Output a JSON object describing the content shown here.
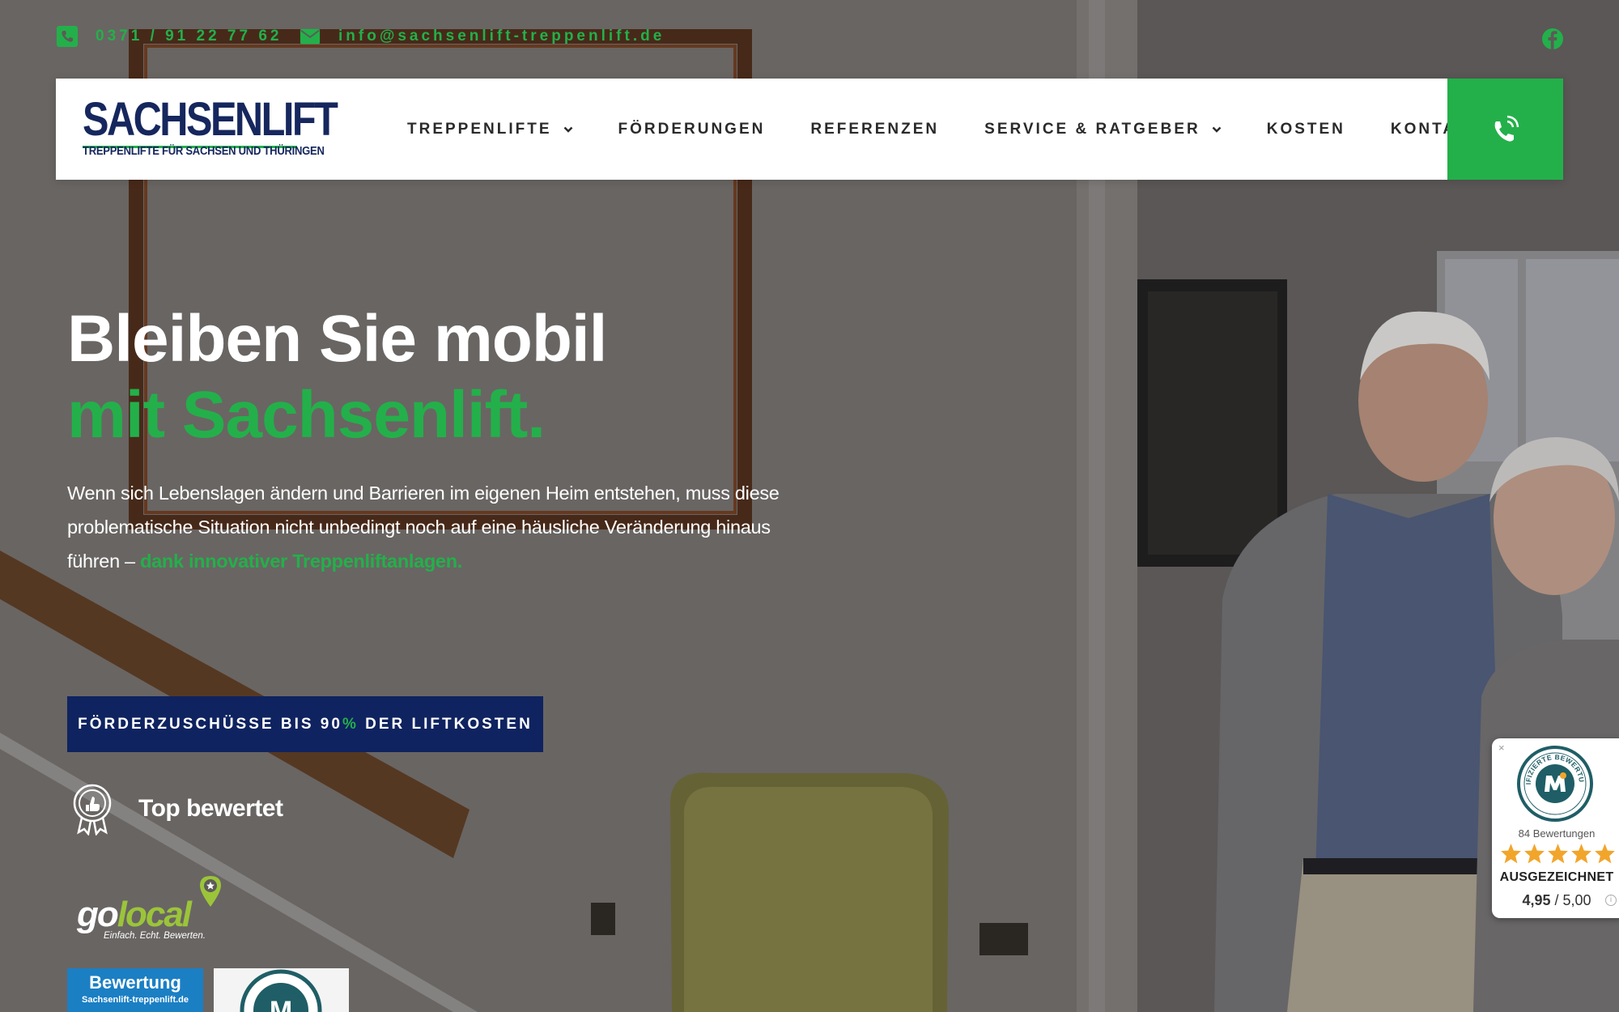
{
  "topbar": {
    "phone": "0371 / 91 22 77 62",
    "email": "info@sachsenlift-treppenlift.de"
  },
  "logo": {
    "name": "SACHSENLIFT",
    "tagline": "TREPPENLIFTE FÜR SACHSEN UND THÜRINGEN"
  },
  "nav": {
    "items": [
      {
        "label": "TREPPENLIFTE",
        "has_dropdown": true
      },
      {
        "label": "FÖRDERUNGEN",
        "has_dropdown": false
      },
      {
        "label": "REFERENZEN",
        "has_dropdown": false
      },
      {
        "label": "SERVICE & RATGEBER",
        "has_dropdown": true
      },
      {
        "label": "KOSTEN",
        "has_dropdown": false
      },
      {
        "label": "KONTAKT",
        "has_dropdown": false
      }
    ]
  },
  "hero": {
    "title_line1": "Bleiben Sie mobil",
    "title_line2": "mit Sachsenlift.",
    "text": "Wenn sich Lebenslagen ändern und Barrieren im eigenen Heim entstehen, muss diese problematische Situation nicht unbedingt noch auf eine häusliche Veränderung hinaus führen – ",
    "text_highlight": "dank innovativer Treppenliftanlagen.",
    "cta_before": "FÖRDERZUSCHÜSSE BIS 90",
    "cta_pct": "%",
    "cta_after": " DER LIFTKOSTEN",
    "top_rated": "Top bewertet"
  },
  "badges": {
    "golocal_go": "go",
    "golocal_local": "local",
    "golocal_tagline": "Einfach. Echt. Bewerten.",
    "bewertung_title": "Bewertung",
    "bewertung_site": "Sachsenlift-treppenlift.de"
  },
  "widget": {
    "close": "×",
    "count": "84 Bewertungen",
    "award": "AUSGEZEICHNET",
    "score": "4,95",
    "score_max": " / 5,00",
    "info": "i",
    "seal_text": "ZERTIFIZIERTE BEWERTUNGEN"
  },
  "colors": {
    "brand_green": "#23b04a",
    "brand_navy": "#0f2360",
    "star": "#f2a52b"
  }
}
